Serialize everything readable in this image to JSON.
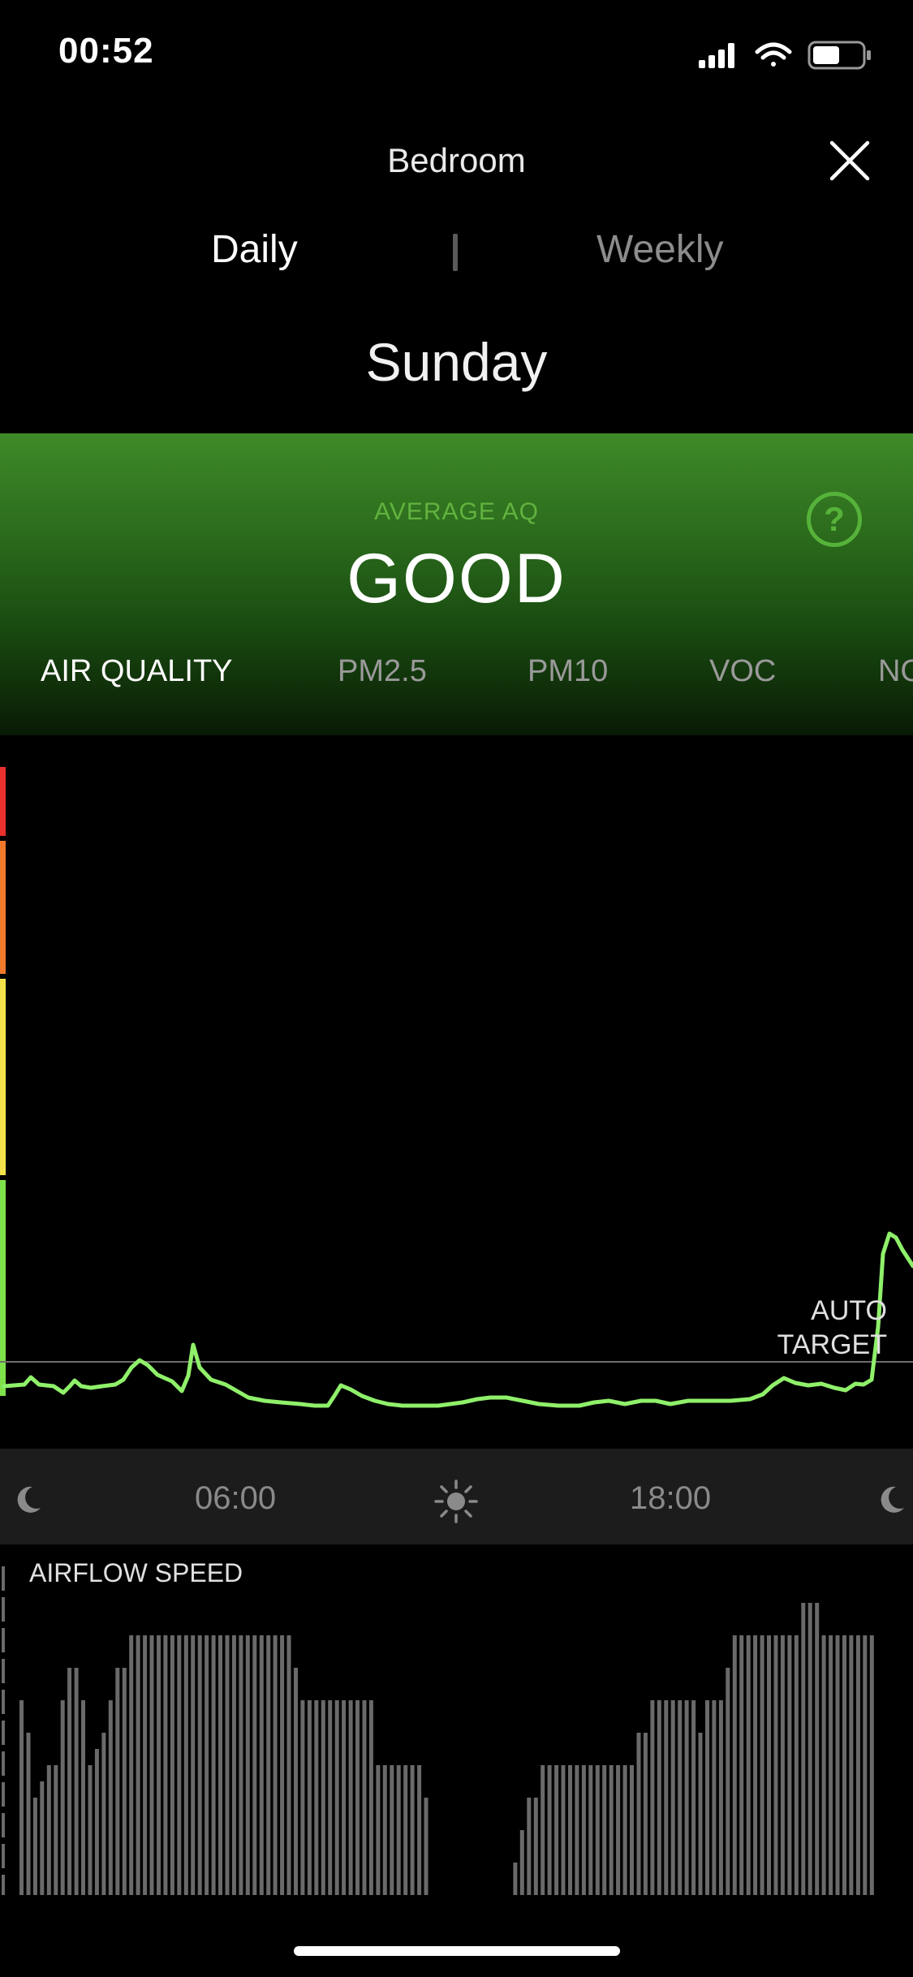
{
  "status_bar": {
    "time": "00:52",
    "icons": [
      "signal-icon",
      "wifi-icon",
      "battery-icon"
    ]
  },
  "header": {
    "room": "Bedroom",
    "close_icon": "close-icon"
  },
  "view_toggle": {
    "daily": "Daily",
    "weekly": "Weekly",
    "active": "Daily"
  },
  "day": "Sunday",
  "summary": {
    "label": "AVERAGE AQ",
    "value": "GOOD",
    "help_icon": "question-icon",
    "help_glyph": "?"
  },
  "tabs": [
    {
      "label": "AIR QUALITY",
      "active": true
    },
    {
      "label": "PM2.5",
      "active": false
    },
    {
      "label": "PM10",
      "active": false
    },
    {
      "label": "VOC",
      "active": false
    },
    {
      "label": "NO",
      "active": false
    }
  ],
  "chart": {
    "auto_target_line1": "AUTO",
    "auto_target_line2": "TARGET",
    "line_color": "#8ff06a",
    "band_colors": [
      "#e8302c",
      "#f07a2a",
      "#f4e24a",
      "#7ee24a"
    ],
    "time_ticks": {
      "t1": "06:00",
      "t2": "18:00"
    },
    "time_icons": [
      "moon-icon",
      "sun-icon",
      "moon-icon"
    ]
  },
  "airflow": {
    "title": "AIRFLOW SPEED",
    "bar_color": "#6a6a6a",
    "levels": [
      6,
      5,
      3,
      3.5,
      4,
      4,
      6,
      7,
      7,
      6,
      4,
      4.5,
      5,
      6,
      7,
      7,
      8,
      8,
      8,
      8,
      8,
      8,
      8,
      8,
      8,
      8,
      8,
      8,
      8,
      8,
      8,
      8,
      8,
      8,
      8,
      8,
      8,
      8,
      8,
      8,
      7,
      6,
      6,
      6,
      6,
      6,
      6,
      6,
      6,
      6,
      6,
      6,
      4,
      4,
      4,
      4,
      4,
      4,
      4,
      3,
      0,
      0,
      0,
      0,
      0,
      0,
      0,
      0,
      0,
      0,
      0,
      0,
      1,
      2,
      3,
      3,
      4,
      4,
      4,
      4,
      4,
      4,
      4,
      4,
      4,
      4,
      4,
      4,
      4,
      4,
      5,
      5,
      6,
      6,
      6,
      6,
      6,
      6,
      6,
      5,
      6,
      6,
      6,
      7,
      8,
      8,
      8,
      8,
      8,
      8,
      8,
      8,
      8,
      8,
      9,
      9,
      9,
      8,
      8,
      8,
      8,
      8,
      8,
      8,
      8
    ]
  }
}
